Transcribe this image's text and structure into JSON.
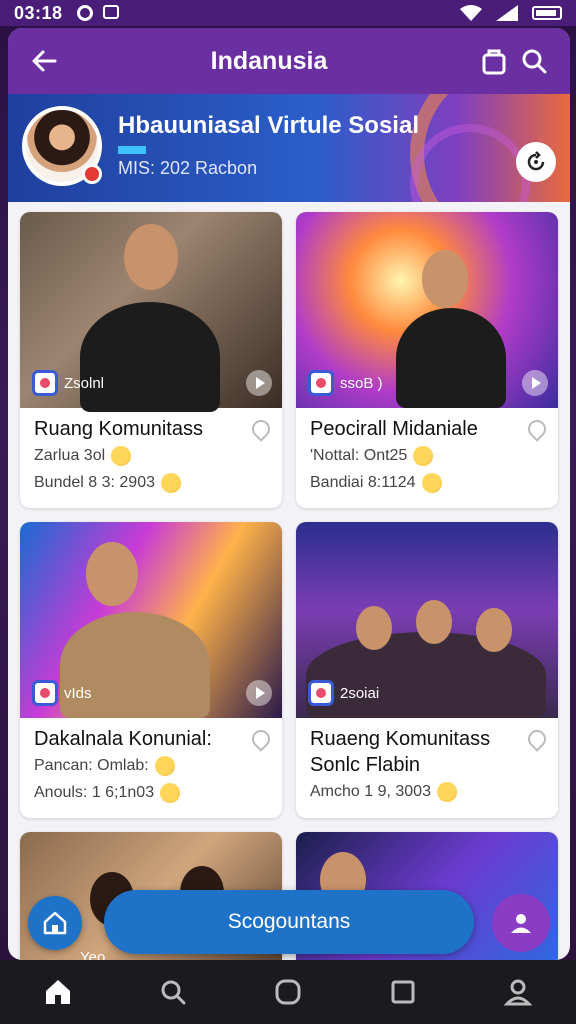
{
  "status_bar": {
    "time": "03:18"
  },
  "app_bar": {
    "title": "Indanusia"
  },
  "banner": {
    "title": "Hbauuniasal Virtule Sosial",
    "subtitle": "MIS: 202 Racbon"
  },
  "cards": [
    {
      "tag": "Zsolnl",
      "title": "Ruang Komunitass",
      "line1": "Zarlua 3ol",
      "line2": "Bundel 8 3: 2903"
    },
    {
      "tag": "ssoB )",
      "title": "Peocirall Midaniale",
      "line1": "'Nottal: Ont25",
      "line2": "Bandiai 8:1124"
    },
    {
      "tag": "vIds",
      "title": "Dakalnala Konunial:",
      "line1": "Pancan: Omlab:",
      "line2": "Anouls: 1 6;1n03"
    },
    {
      "tag": "2soiai",
      "title": "Ruaeng Komunitass Sonlc Flabin",
      "line1": "",
      "line2": "Amcho 1 9, 3003"
    }
  ],
  "partial_cards": [
    {
      "tag": "Yeo"
    },
    {
      "tag": ""
    }
  ],
  "main_action": {
    "label": "Scogountans"
  },
  "colors": {
    "app_bar": "#6a2fa0",
    "primary": "#1e73c9",
    "accent": "#8a3cc4"
  }
}
